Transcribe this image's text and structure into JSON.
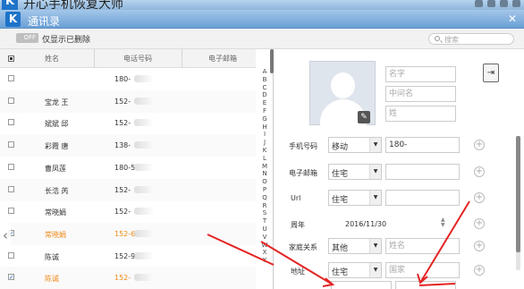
{
  "app": {
    "title": "开心手机恢复大师",
    "logo": "K"
  },
  "dialog": {
    "title": "通讯录",
    "logo": "K",
    "close": "✕"
  },
  "toolbar": {
    "toggle_state": "OFF",
    "toggle_label": "仅显示已删除",
    "search_placeholder": "搜索"
  },
  "table": {
    "headers": {
      "name": "姓名",
      "phone": "电话号码",
      "email": "电子邮箱"
    },
    "rows": [
      {
        "name": "",
        "phone": "180-",
        "checked": false,
        "highlight": false
      },
      {
        "name": "宝龙 王",
        "phone": "152-",
        "checked": false,
        "highlight": false
      },
      {
        "name": "斌斌 邱",
        "phone": "152-",
        "checked": false,
        "highlight": false
      },
      {
        "name": "彩霞 唐",
        "phone": "138-",
        "checked": false,
        "highlight": false
      },
      {
        "name": "曹凤莲",
        "phone": "180-5",
        "checked": false,
        "highlight": false
      },
      {
        "name": "长浩 芮",
        "phone": "152-",
        "checked": false,
        "highlight": false
      },
      {
        "name": "常晓娟",
        "phone": "152-",
        "checked": false,
        "highlight": false
      },
      {
        "name": "常晓娟",
        "phone": "152-6",
        "checked": true,
        "highlight": true
      },
      {
        "name": "陈诚",
        "phone": "152-9",
        "checked": false,
        "highlight": false
      },
      {
        "name": "陈诚",
        "phone": "152-",
        "checked": true,
        "highlight": true
      }
    ],
    "alphabet": [
      "A",
      "B",
      "C",
      "D",
      "E",
      "F",
      "G",
      "H",
      "I",
      "J",
      "K",
      "L",
      "M",
      "N",
      "O",
      "P",
      "Q",
      "R",
      "S",
      "T",
      "U",
      "V",
      "W",
      "X",
      "Y"
    ]
  },
  "detail": {
    "first_name_placeholder": "名字",
    "middle_name_placeholder": "中间名",
    "last_name_placeholder": "姓",
    "phone": {
      "label": "手机号码",
      "type": "移动",
      "value": "180-"
    },
    "email": {
      "label": "电子邮箱",
      "type": "住宅"
    },
    "url": {
      "label": "Url",
      "type": "住宅"
    },
    "anniversary": {
      "label": "周年",
      "value": "2016/11/30"
    },
    "relation": {
      "label": "家庭关系",
      "type": "其他",
      "placeholder": "姓名"
    },
    "address": {
      "label": "地址",
      "type": "住宅",
      "country_placeholder": "国家"
    }
  },
  "colors": {
    "highlight": "#f08a16",
    "annotation": "#e52323",
    "header_blue": "#6aa0d6"
  }
}
